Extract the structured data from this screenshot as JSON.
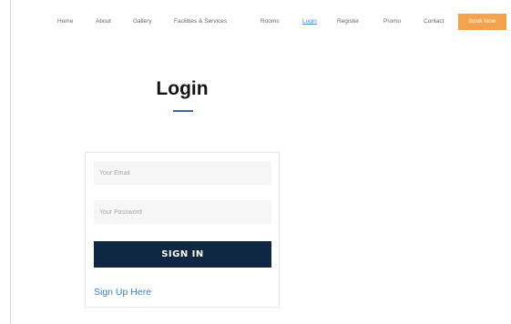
{
  "nav": {
    "items": [
      {
        "label": "Home"
      },
      {
        "label": "About"
      },
      {
        "label": "Gallery"
      },
      {
        "label": "Facilities & Services"
      },
      {
        "label": "Rooms"
      },
      {
        "label": "Login",
        "active": true
      },
      {
        "label": "Register"
      },
      {
        "label": "Promo"
      },
      {
        "label": "Contact"
      }
    ],
    "book_now_label": "Book Now",
    "book_now_color": "#f2a34c",
    "active_color": "#4a86c8"
  },
  "login": {
    "title": "Login",
    "email_placeholder": "Your Email",
    "password_placeholder": "Your Password",
    "signin_label": "SIGN IN",
    "signin_color": "#102743",
    "signup_label": "Sign Up Here"
  }
}
